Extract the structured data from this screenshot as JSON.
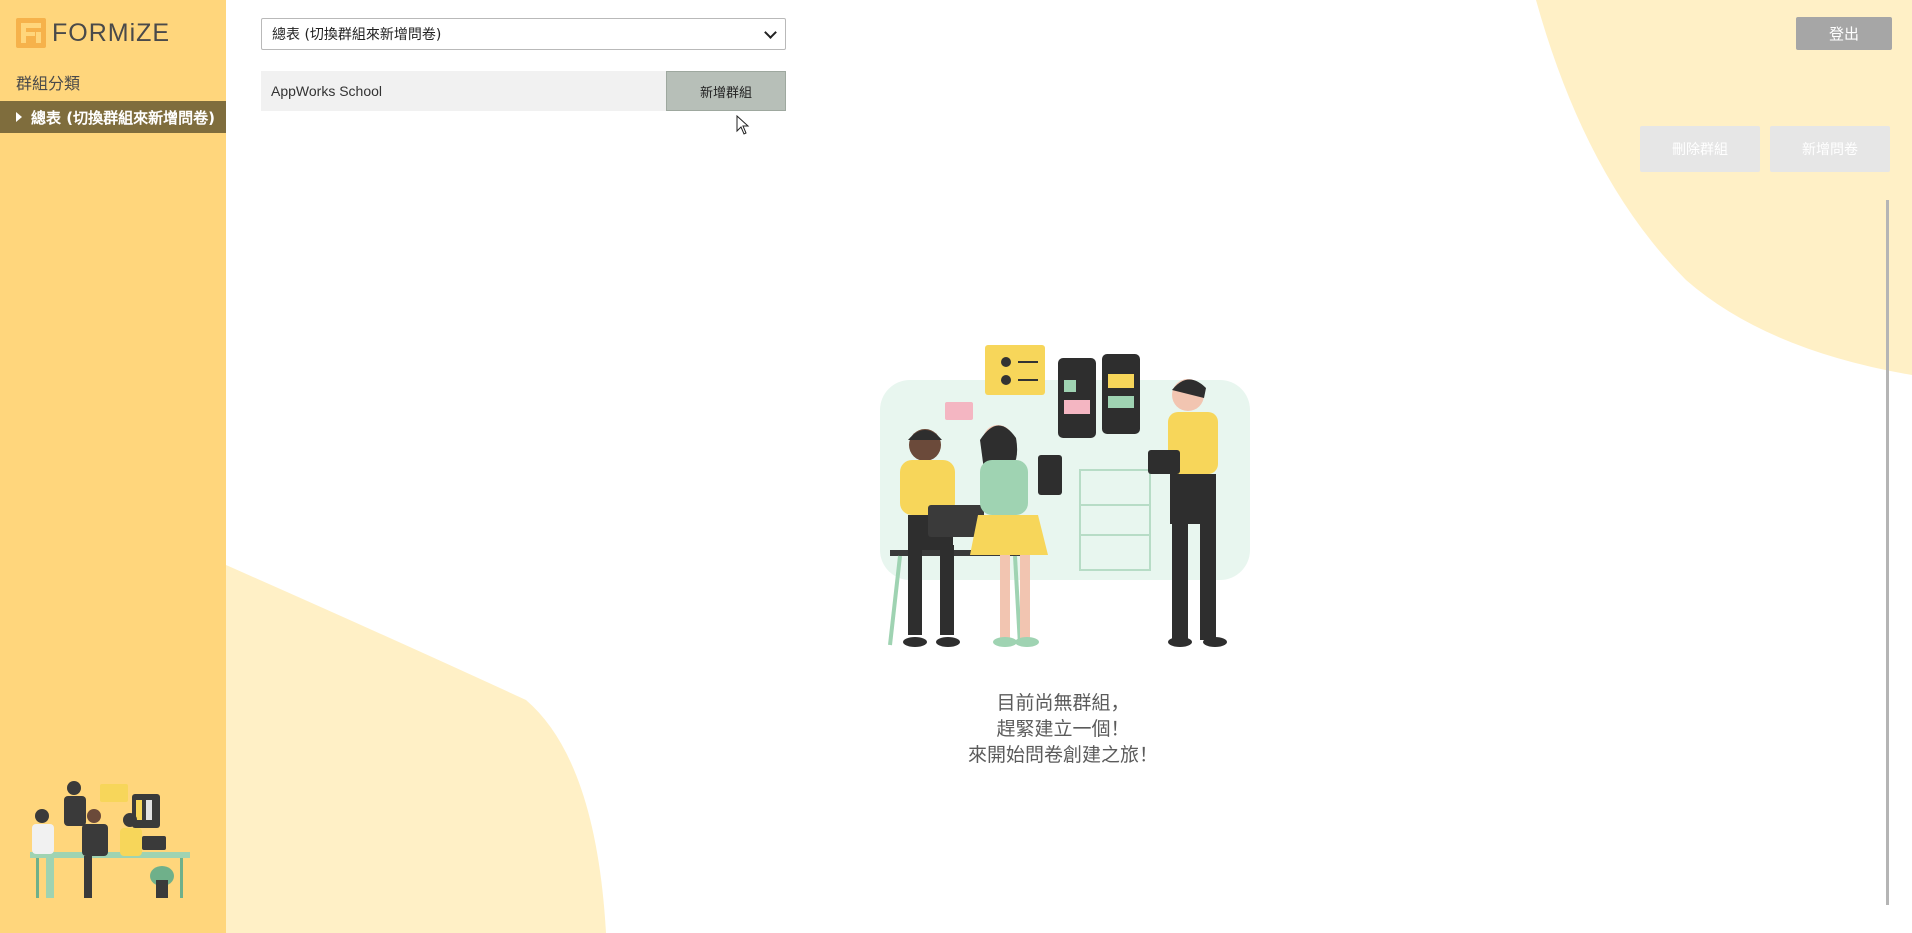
{
  "brand": {
    "name": "FORMiZE",
    "logo_letters": "F"
  },
  "colors": {
    "sidebar": "#ffd67c",
    "sidebar_active": "#7f6d3d",
    "blob": "#fff0c6",
    "accent_button": "#b7bfb8"
  },
  "sidebar": {
    "heading": "群組分類",
    "items": [
      {
        "label": "總表 (切換群組來新增問卷)",
        "active": true
      }
    ]
  },
  "toolbar": {
    "group_select": {
      "selected": "總表 (切換群組來新增問卷)"
    },
    "new_group_input": {
      "value": "AppWorks School"
    },
    "new_group_button": "新增群組",
    "logout_button": "登出",
    "delete_group_button": "刪除群組",
    "new_form_button": "新增問卷"
  },
  "empty_state": {
    "lines": [
      "目前尚無群組，",
      "趕緊建立一個！",
      "來開始問卷創建之旅！"
    ]
  },
  "icons": {
    "caret": "caret-right-icon",
    "chevron": "chevron-down-icon",
    "cursor": "mouse-cursor-icon"
  }
}
